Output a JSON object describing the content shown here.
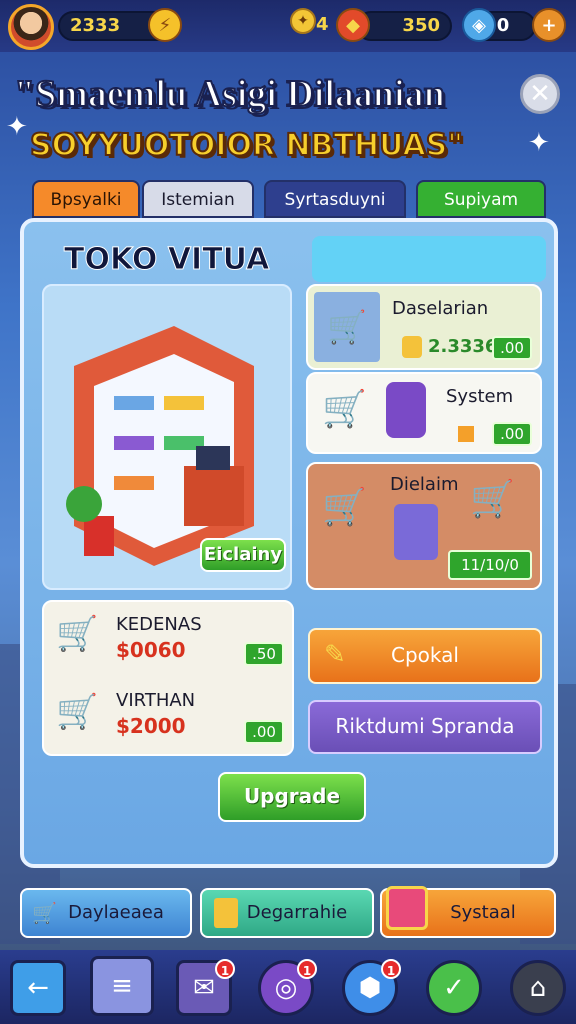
{
  "topbar": {
    "player_currency": "2333",
    "gems_value": "350",
    "energy_value": "0",
    "resource_value": "4"
  },
  "header": {
    "title_line1": "\"Smaemlu Asigi Dilaanian",
    "title_line2": "SOYYUOTOIOR NBTHUAS\""
  },
  "tabs": [
    {
      "label": "Bpsyalki",
      "color": "#f58a2a"
    },
    {
      "label": "Istemian",
      "color": "#d7dbe8"
    },
    {
      "label": "Syrtasduyni",
      "color": "#2e3f8e"
    },
    {
      "label": "Supiyam",
      "color": "#35b032"
    }
  ],
  "store": {
    "title": "TOKO VITUA",
    "buy_button": "Eiclainy"
  },
  "cards": {
    "card1": {
      "label": "Daselarian",
      "price": "2.3336",
      "button": ".00"
    },
    "card2": {
      "label": "System",
      "button": ".00"
    },
    "card3": {
      "label": "Dielaim",
      "button": "11/10/0"
    }
  },
  "items": [
    {
      "name": "KEDENAS",
      "price": "$0060",
      "button": ".50"
    },
    {
      "name": "VIRTHAN",
      "price": "$2000",
      "button": ".00"
    }
  ],
  "buttons": {
    "cpokal": "Cpokal",
    "riktdum": "Riktdumi Spranda",
    "upgrade": "Upgrade"
  },
  "actions": {
    "a1": "Daylaeaea",
    "a2": "Degarrahie",
    "a3": "Systaal"
  },
  "nav_badges": {
    "b1": "1",
    "b2": "1",
    "b3": "1"
  },
  "colors": {
    "accent_orange": "#f58a2a",
    "accent_green": "#35b032",
    "accent_purple": "#6a4fb6"
  }
}
